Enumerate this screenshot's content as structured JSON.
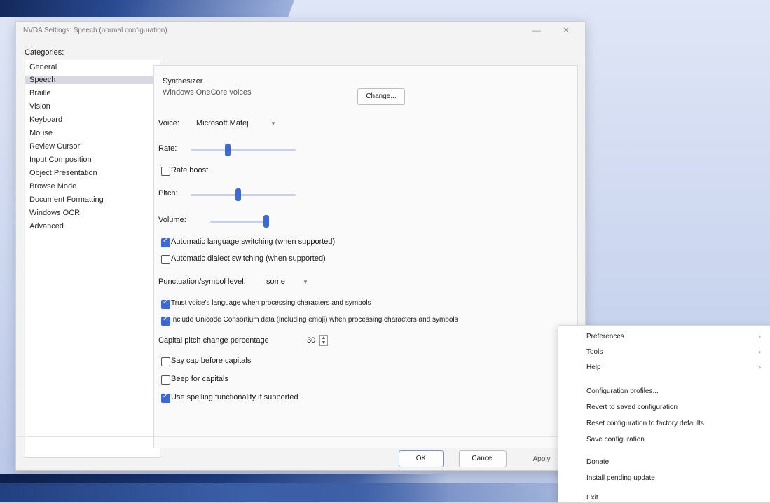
{
  "window": {
    "title": "NVDA Settings: Speech (normal configuration)",
    "minimize_glyph": "—",
    "close_glyph": "✕"
  },
  "categories": {
    "label": "Categories:",
    "items": [
      {
        "label": "General"
      },
      {
        "label": "Speech",
        "selected": true
      },
      {
        "label": "Braille"
      },
      {
        "label": "Vision"
      },
      {
        "label": "Keyboard"
      },
      {
        "label": "Mouse"
      },
      {
        "label": "Review Cursor"
      },
      {
        "label": "Input Composition"
      },
      {
        "label": "Object Presentation"
      },
      {
        "label": "Browse Mode"
      },
      {
        "label": "Document Formatting"
      },
      {
        "label": "Windows OCR"
      },
      {
        "label": "Advanced"
      }
    ]
  },
  "speech": {
    "synth_group_label": "Synthesizer",
    "synth_value": "Windows OneCore voices",
    "change_button": "Change...",
    "voice_label": "Voice:",
    "voice_value": "Microsoft Matej",
    "rate_label": "Rate:",
    "rate_level": 0.35,
    "rate_boost_label": "Rate boost",
    "rate_boost_checked": false,
    "pitch_label": "Pitch:",
    "pitch_level": 0.45,
    "volume_label": "Volume:",
    "volume_level": 1.0,
    "auto_lang_label": "Automatic language switching (when supported)",
    "auto_lang_checked": true,
    "auto_dialect_label": "Automatic dialect switching (when supported)",
    "auto_dialect_checked": false,
    "punct_label": "Punctuation/symbol level:",
    "punct_value": "some",
    "trust_voice_label": "Trust voice's language when processing characters and symbols",
    "trust_voice_checked": true,
    "unicode_cldr_label": "Include Unicode Consortium data (including emoji) when processing characters and symbols",
    "unicode_cldr_checked": true,
    "cap_pitch_label": "Capital pitch change percentage",
    "cap_pitch_value": "30",
    "say_cap_label": "Say cap before capitals",
    "say_cap_checked": false,
    "beep_caps_label": "Beep for capitals",
    "beep_caps_checked": false,
    "spelling_label": "Use spelling functionality if supported",
    "spelling_checked": true
  },
  "footer": {
    "ok": "OK",
    "cancel": "Cancel",
    "apply": "Apply"
  },
  "menu": {
    "items": [
      {
        "label": "Preferences",
        "submenu": true
      },
      {
        "label": "Tools",
        "submenu": true
      },
      {
        "label": "Help",
        "submenu": true
      },
      {
        "label": "Configuration profiles..."
      },
      {
        "label": "Revert to saved configuration"
      },
      {
        "label": "Reset configuration to factory defaults"
      },
      {
        "label": "Save configuration"
      },
      {
        "label": "Donate"
      },
      {
        "label": "Install pending update"
      },
      {
        "label": "Exit"
      }
    ],
    "submenu_glyph": "›"
  },
  "colors": {
    "accent": "#3c69d6",
    "selected_bg": "#d9d9e4"
  }
}
